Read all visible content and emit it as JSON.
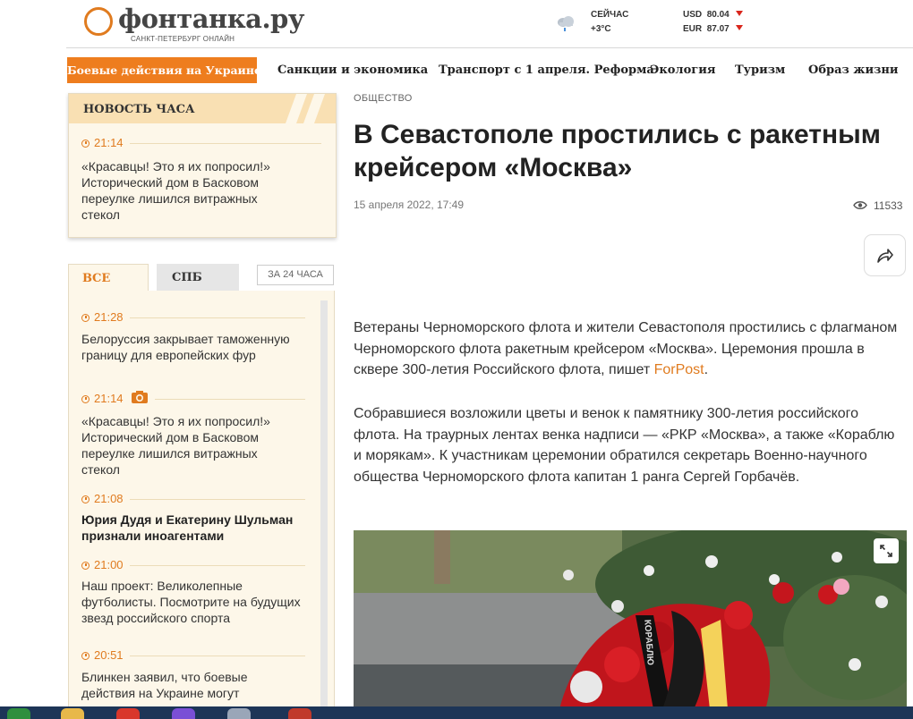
{
  "header": {
    "logo_text": "фонтанка.ру",
    "logo_sub": "САНКТ-ПЕТЕРБУРГ ОНЛАЙН",
    "weather_label": "СЕЙЧАС",
    "weather_temp": "+3°C",
    "currencies": [
      {
        "code": "USD",
        "value": "80.04"
      },
      {
        "code": "EUR",
        "value": "87.07"
      }
    ]
  },
  "nav": {
    "items": [
      "Боевые действия на Украине",
      "Санкции и экономика",
      "Транспорт с 1 апреля. Реформа",
      "Экология",
      "Туризм",
      "Образ жизни"
    ]
  },
  "hour_news": {
    "title": "НОВОСТЬ ЧАСА",
    "time": "21:14",
    "text": "«Красавцы! Это я их попросил!» Исторический дом в Басковом переулке лишился витражных стекол"
  },
  "feed": {
    "tabs": [
      "ВСЕ",
      "СПБ"
    ],
    "period": "ЗА 24 ЧАСА",
    "items": [
      {
        "time": "21:28",
        "text": "Белоруссия закрывает таможенную границу для европейских фур"
      },
      {
        "time": "21:14",
        "text": "«Красавцы! Это я их попросил!» Исторический дом в Басковом переулке лишился витражных стекол"
      },
      {
        "time": "21:08",
        "text": "Юрия Дудя и Екатерину Шульман признали иноагентами"
      },
      {
        "time": "21:00",
        "text": "Наш проект: Великолепные футболисты. Посмотрите на будущих звезд российского спорта"
      },
      {
        "time": "20:51",
        "text": "Блинкен заявил, что боевые действия на Украине могут"
      }
    ]
  },
  "article": {
    "rubric": "ОБЩЕСТВО",
    "title": "В Севастополе простились с ракетным крейсером «Москва»",
    "date": "15 апреля 2022, 17:49",
    "views": "11533",
    "para1_before": "Ветераны Черноморского флота и жители Севастополя простились с флагманом Черноморского флота ракетным крейсером «Москва». Церемония прошла в сквере 300-летия Российского флота, пишет ",
    "para1_link": "ForPost",
    "para1_after": ".",
    "para2": "Собравшиеся возложили цветы и венок к памятнику 300-летия российского флота. На траурных лентах венка надписи — «РКР «Москва», а также «Кораблю и морякам». К участникам церемонии обратился секретарь Военно-научного общества Черноморского флота капитан 1 ранга Сергей Горбачёв.",
    "ribbon_text": "КОРАБЛЮ"
  },
  "colors": {
    "accent": "#ee7d1e",
    "hour_head": "#f9e0b3",
    "feed_bg": "#fdf7e9",
    "down_arrow": "#d9261c"
  }
}
